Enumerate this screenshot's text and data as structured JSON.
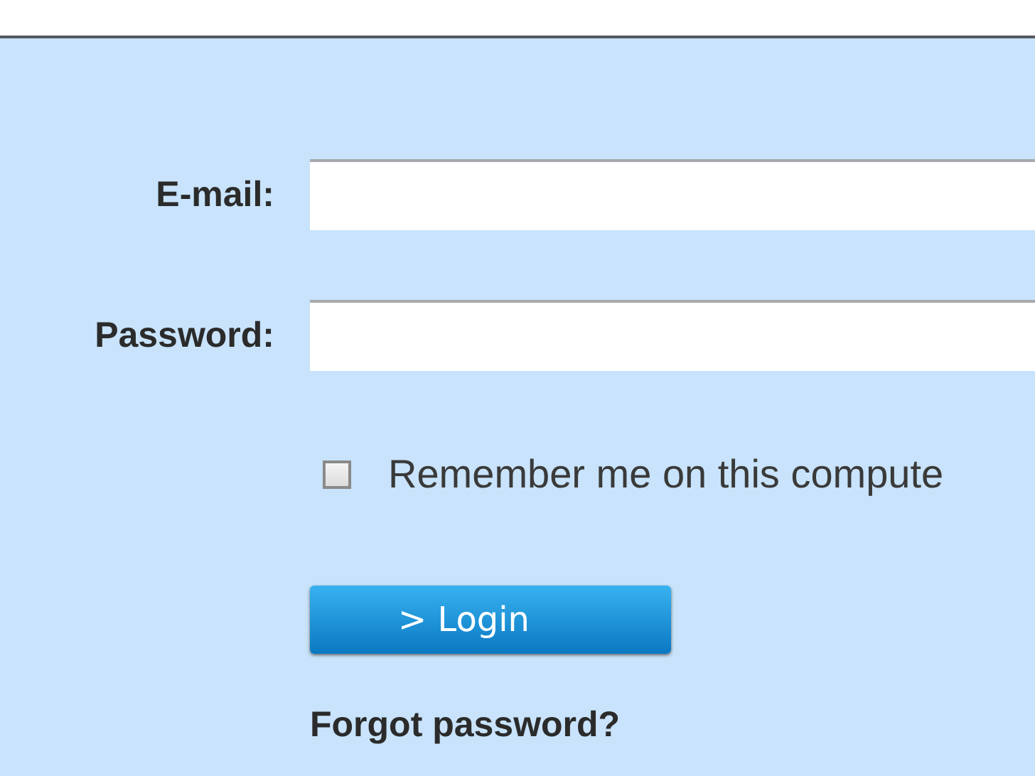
{
  "form": {
    "email": {
      "label": "E-mail:"
    },
    "password": {
      "label": "Password:"
    },
    "remember": {
      "label": "Remember me on this compute",
      "checked": false
    },
    "login_button": "> Login",
    "forgot_link": "Forgot password?"
  }
}
